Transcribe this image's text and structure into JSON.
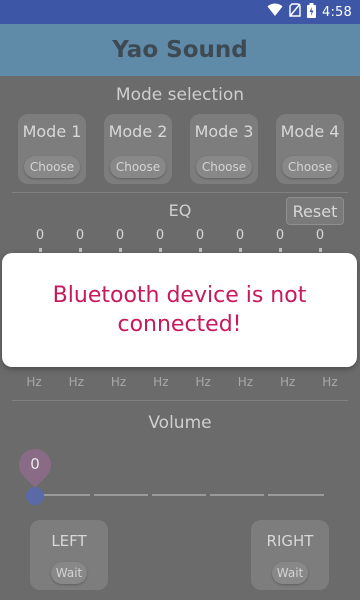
{
  "status_bar": {
    "time": "4:58",
    "icons": [
      "wifi-icon",
      "no-sim-icon",
      "battery-charging-icon"
    ]
  },
  "app": {
    "title": "Yao Sound"
  },
  "mode_section": {
    "title": "Mode selection",
    "modes": [
      {
        "label": "Mode 1",
        "button": "Choose"
      },
      {
        "label": "Mode 2",
        "button": "Choose"
      },
      {
        "label": "Mode 3",
        "button": "Choose"
      },
      {
        "label": "Mode 4",
        "button": "Choose"
      }
    ]
  },
  "eq": {
    "title": "EQ",
    "reset_label": "Reset",
    "values": [
      "0",
      "0",
      "0",
      "0",
      "0",
      "0",
      "0",
      "0"
    ],
    "units": [
      "Hz",
      "Hz",
      "Hz",
      "Hz",
      "Hz",
      "Hz",
      "Hz",
      "Hz"
    ]
  },
  "volume": {
    "title": "Volume",
    "value": "0",
    "level": 0
  },
  "channels": {
    "left": {
      "label": "LEFT",
      "button": "Wait"
    },
    "right": {
      "label": "RIGHT",
      "button": "Wait"
    }
  },
  "dialog": {
    "message": "Bluetooth device is not connected!"
  },
  "colors": {
    "status_bar": "#3d56a6",
    "app_bar": "#5f8aa8",
    "dialog_text": "#c9185c",
    "slider_thumb": "#5a6aa6",
    "value_bubble": "#8a6b85"
  }
}
